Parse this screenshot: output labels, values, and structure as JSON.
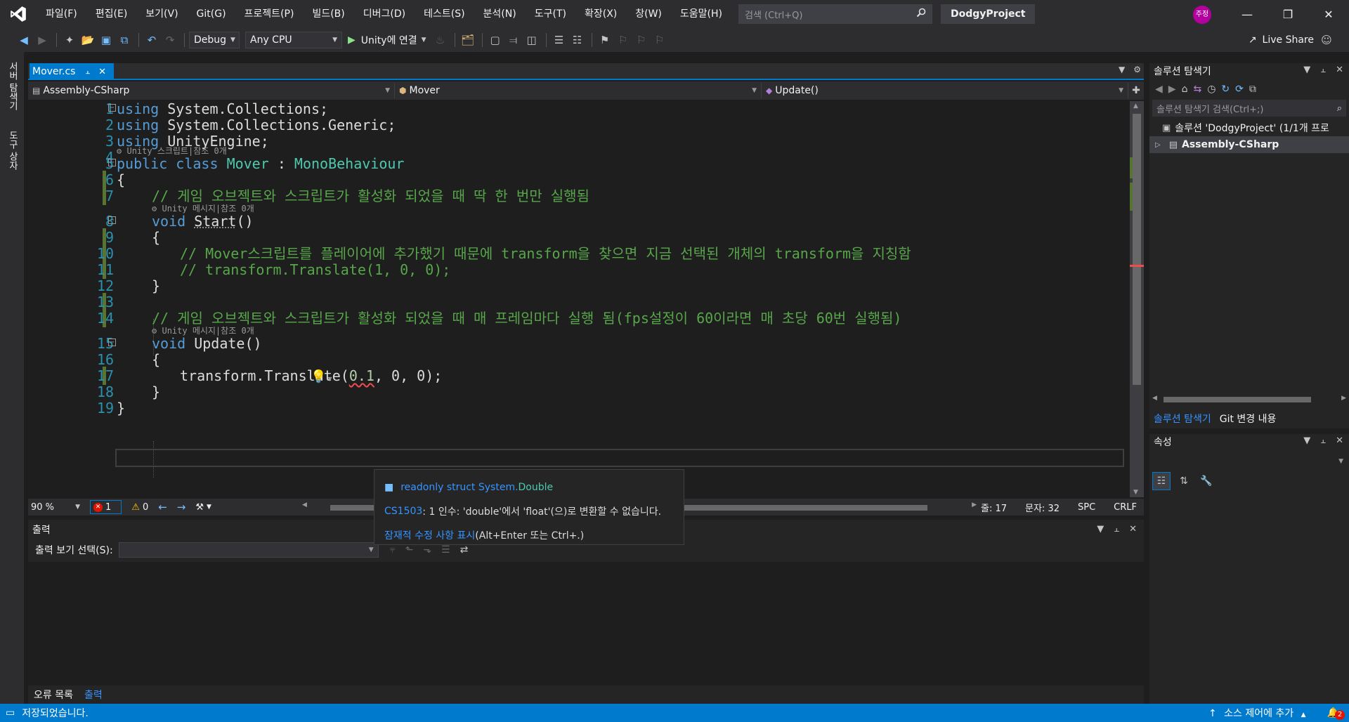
{
  "menu": {
    "items": [
      "파일(F)",
      "편집(E)",
      "보기(V)",
      "Git(G)",
      "프로젝트(P)",
      "빌드(B)",
      "디버그(D)",
      "테스트(S)",
      "분석(N)",
      "도구(T)",
      "확장(X)",
      "창(W)",
      "도움말(H)"
    ],
    "search_placeholder": "검색 (Ctrl+Q)",
    "project_name": "DodgyProject",
    "user_initials": "주정"
  },
  "toolbar": {
    "config": "Debug",
    "platform": "Any CPU",
    "run_label": "Unity에 연결",
    "live_share": "Live Share"
  },
  "left_strip": {
    "tabs": [
      "서버 탐색기",
      "도구 상자"
    ]
  },
  "editor": {
    "tab_name": "Mover.cs",
    "nav": {
      "project": "Assembly-CSharp",
      "class": "Mover",
      "member": "Update()"
    },
    "code_lens": {
      "class": "Unity 스크립트|참조 0개",
      "method": "Unity 메시지|참조 0개"
    },
    "lines": [
      {
        "n": "1",
        "text": "using System.Collections;"
      },
      {
        "n": "2",
        "text": "using System.Collections.Generic;"
      },
      {
        "n": "3",
        "text": "using UnityEngine;"
      },
      {
        "n": "4",
        "text": ""
      },
      {
        "n": "5",
        "text": "public class Mover : MonoBehaviour"
      },
      {
        "n": "6",
        "text": "{"
      },
      {
        "n": "7",
        "text": "// 게임 오브젝트와 스크립트가 활성화 되었을 때 딱 한 번만 실행됨"
      },
      {
        "n": "8",
        "text": "void Start()"
      },
      {
        "n": "9",
        "text": "{"
      },
      {
        "n": "10",
        "text": "// Mover스크립트를 플레이어에 추가했기 때문에 transform을 찾으면 지금 선택된 개체의 transform을 지칭함"
      },
      {
        "n": "11",
        "text": "// transform.Translate(1, 0, 0);"
      },
      {
        "n": "12",
        "text": "}"
      },
      {
        "n": "13",
        "text": ""
      },
      {
        "n": "14",
        "text": "// 게임 오브젝트와 스크립트가 활성화 되었을 때 매 프레임마다 실행 됨(fps설정이 60이라면 매 초당 60번 실행됨)"
      },
      {
        "n": "15",
        "text": "void Update()"
      },
      {
        "n": "16",
        "text": "{"
      },
      {
        "n": "17",
        "text": "transform.Translate(0.1, 0, 0);"
      },
      {
        "n": "18",
        "text": "}"
      },
      {
        "n": "19",
        "text": "}"
      }
    ],
    "tokens": {
      "using": "using",
      "system_collections": "System.Collections;",
      "system_generic": "System.Collections.Generic;",
      "unity_engine": "UnityEngine;",
      "public": "public",
      "class": "class",
      "mover": "Mover",
      "colon": ":",
      "monobehaviour": "MonoBehaviour",
      "void": "void",
      "start_name": "Start",
      "update_name": "Update",
      "parens": "()",
      "translate_call": "transform.Translate(",
      "arg_double": "0.1",
      "arg_rest": ", 0, 0);",
      "brace_open": "{",
      "brace_close": "}"
    },
    "status": {
      "zoom": "90 %",
      "errors": "1",
      "warnings": "0",
      "line": "줄: 17",
      "char": "문자: 32",
      "spc": "SPC",
      "eol": "CRLF"
    }
  },
  "tooltip": {
    "type_prefix": "readonly struct System.",
    "type_name": "Double",
    "error_code": "CS1503",
    "error_msg": ": 1 인수: 'double'에서 'float'(으)로 변환할 수 없습니다.",
    "fix_link": "잠재적 수정 사항 표시",
    "fix_hint": " (Alt+Enter 또는 Ctrl+.)"
  },
  "output": {
    "title": "출력",
    "select_label": "출력 보기 선택(S):",
    "tabs": [
      "오류 목록",
      "출력"
    ]
  },
  "solution_explorer": {
    "title": "솔루션 탐색기",
    "search_placeholder": "솔루션 탐색기 검색(Ctrl+;)",
    "solution_row": "솔루션 'DodgyProject' (1/1개 프로",
    "project_row": "Assembly-CSharp",
    "tabs": [
      "솔루션 탐색기",
      "Git 변경 내용"
    ]
  },
  "properties": {
    "title": "속성"
  },
  "statusbar": {
    "message": "저장되었습니다.",
    "source_control": "소스 제어에 추가",
    "notifications": "2"
  },
  "colors": {
    "accent": "#007acc",
    "keyword": "#569cd6",
    "type": "#4ec9b0",
    "comment": "#57a64a",
    "line_number": "#2b91af",
    "error": "#f14c4c",
    "changed_marker": "#577430"
  }
}
